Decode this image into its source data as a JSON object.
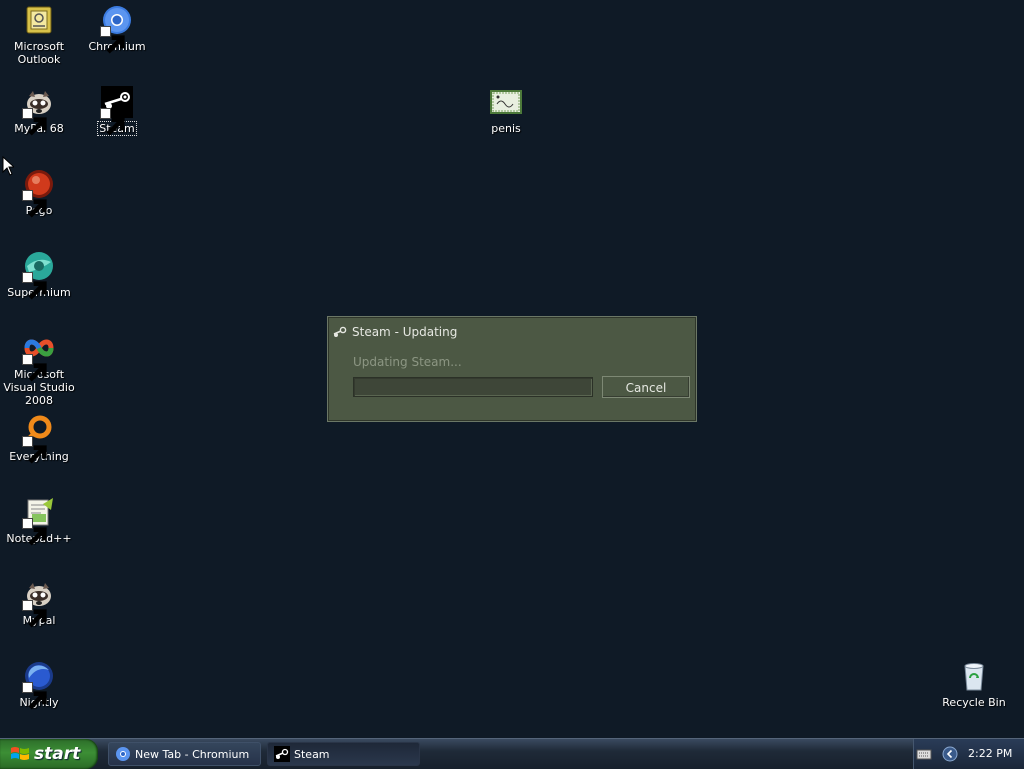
{
  "desktop_icons": [
    {
      "label": "Microsoft Outlook",
      "icon": "outlook-icon",
      "shortcut": false
    },
    {
      "label": "Chromium",
      "icon": "chromium-icon",
      "shortcut": true
    },
    {
      "label": "MyPal 68",
      "icon": "mypal-icon",
      "shortcut": true
    },
    {
      "label": "Steam",
      "icon": "steam-icon",
      "shortcut": true,
      "selected": true
    },
    {
      "label": "penis",
      "icon": "file-icon",
      "shortcut": false
    },
    {
      "label": "Pego",
      "icon": "pego-icon",
      "shortcut": true
    },
    {
      "label": "Supermium",
      "icon": "supermium-icon",
      "shortcut": true
    },
    {
      "label": "Microsoft Visual Studio 2008",
      "icon": "visual-studio-icon",
      "shortcut": true
    },
    {
      "label": "Everything",
      "icon": "everything-icon",
      "shortcut": true
    },
    {
      "label": "Notepad++",
      "icon": "notepadpp-icon",
      "shortcut": true
    },
    {
      "label": "Mypal",
      "icon": "mypal-icon",
      "shortcut": true
    },
    {
      "label": "Nightly",
      "icon": "nightly-icon",
      "shortcut": true
    },
    {
      "label": "Recycle Bin",
      "icon": "recycle-bin-icon",
      "shortcut": false
    }
  ],
  "dialog": {
    "title": "Steam - Updating",
    "status": "Updating Steam...",
    "progress": 0,
    "cancel_label": "Cancel"
  },
  "taskbar": {
    "start_label": "start",
    "tasks": [
      {
        "label": "New Tab - Chromium",
        "icon": "chromium-icon"
      },
      {
        "label": "Steam",
        "icon": "steam-icon"
      }
    ],
    "clock": "2:22 PM"
  },
  "colors": {
    "desktop_bg": "#0f1a26",
    "dialog_bg": "#4c5844",
    "start_green": "#3c8f35"
  }
}
